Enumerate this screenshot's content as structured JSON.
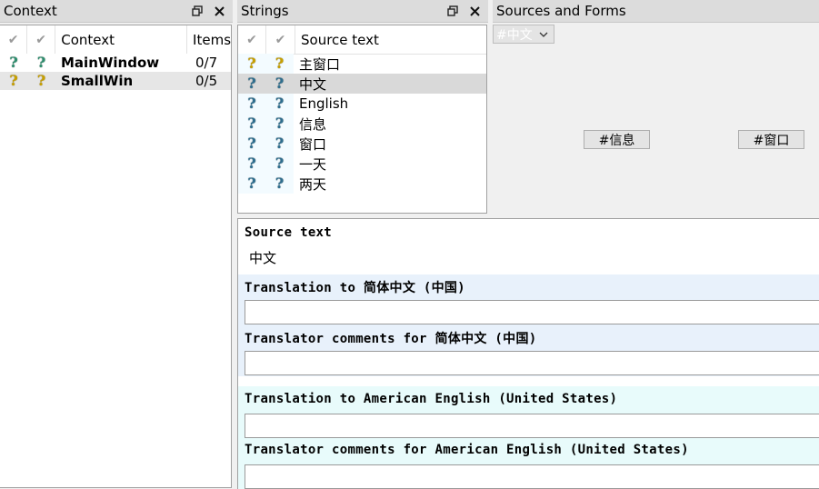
{
  "context_dock": {
    "title": "Context",
    "headers": {
      "context": "Context",
      "items": "Items"
    },
    "rows": [
      {
        "name": "MainWindow",
        "items": "0/7"
      },
      {
        "name": "SmallWin",
        "items": "0/5"
      }
    ]
  },
  "strings_dock": {
    "title": "Strings",
    "header_source": "Source text",
    "rows": [
      "主窗口",
      "中文",
      "English",
      "信息",
      "窗口",
      "一天",
      "两天"
    ]
  },
  "forms_dock": {
    "title": "Sources and Forms",
    "combo_value": "#中文",
    "button_info": "#信息",
    "button_window": "#窗口"
  },
  "editor": {
    "source_label": "Source text",
    "source_value": "中文",
    "translation_zh_label": "Translation to 简体中文 (中国)",
    "comments_zh_label": "Translator comments for 简体中文 (中国)",
    "translation_en_label": "Translation to American English (United States)",
    "comments_en_label": "Translator comments for American English (United States)"
  },
  "icons": {
    "float": "float-icon",
    "close": "close-icon",
    "check": "check-icon",
    "question": "question-mark-icon"
  },
  "colors": {
    "selected_row": "#d9d9d9",
    "zh_band": "#e8f1fb",
    "en_band": "#e8fbfb"
  }
}
